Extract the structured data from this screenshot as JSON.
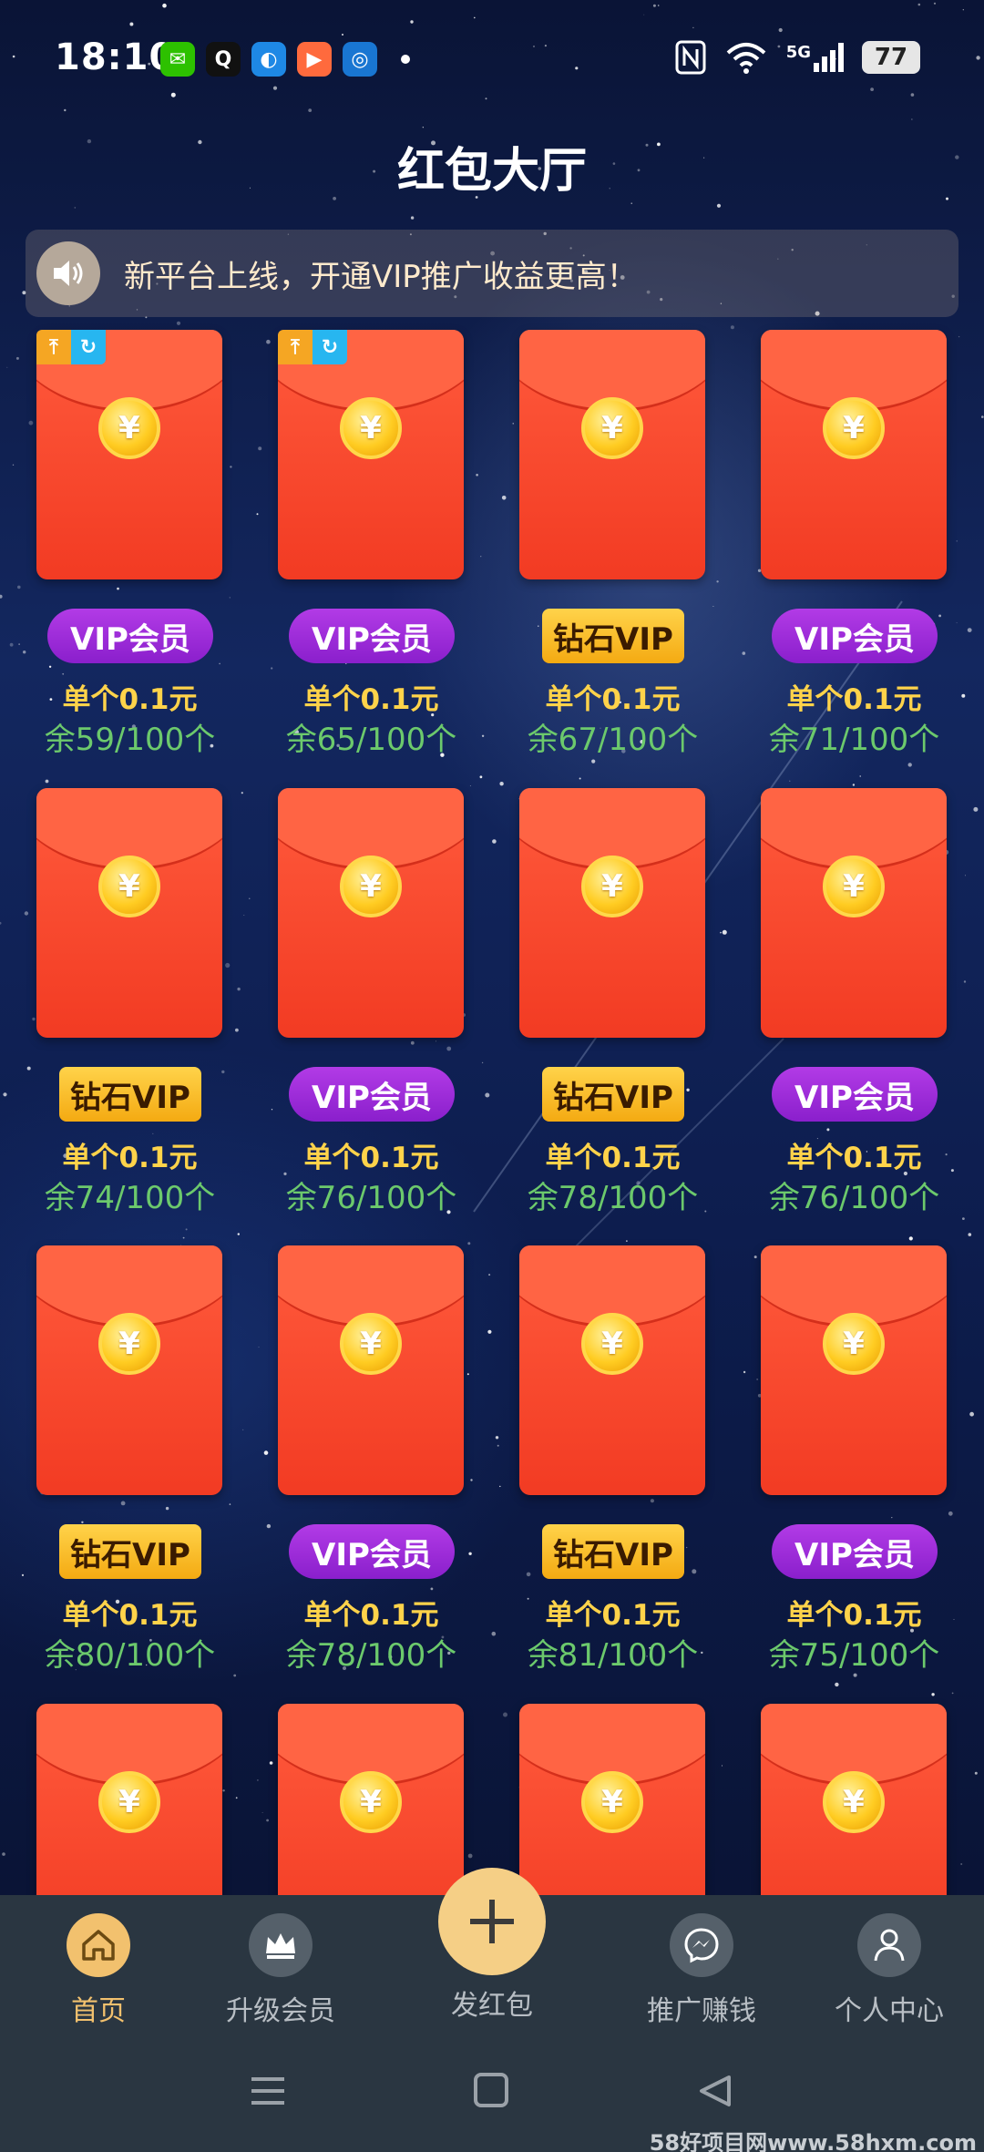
{
  "status_bar": {
    "time": "18:10",
    "apps": [
      {
        "name": "wechat-icon",
        "glyph": "✉",
        "color": "#2dc100"
      },
      {
        "name": "qq-icon",
        "glyph": "Q",
        "color": "#ffffff"
      },
      {
        "name": "browser-icon",
        "glyph": "◐",
        "color": "#1e88e5"
      },
      {
        "name": "video-app-icon",
        "glyph": "▶",
        "color": "#ff6a3d"
      },
      {
        "name": "circle-app-icon",
        "glyph": "◎",
        "color": "#1976d2"
      }
    ],
    "signal": "5G",
    "battery": "77"
  },
  "header": {
    "title": "红包大厅"
  },
  "notice": {
    "text": "新平台上线，开通VIP推广收益更高！"
  },
  "packets": [
    {
      "tier": "VIP会员",
      "tier_type": "vip",
      "price": "单个0.1元",
      "remain": "余59/100个",
      "pinned": true
    },
    {
      "tier": "VIP会员",
      "tier_type": "vip",
      "price": "单个0.1元",
      "remain": "余65/100个",
      "pinned": true
    },
    {
      "tier": "钻石VIP",
      "tier_type": "diamond",
      "price": "单个0.1元",
      "remain": "余67/100个",
      "pinned": false
    },
    {
      "tier": "VIP会员",
      "tier_type": "vip",
      "price": "单个0.1元",
      "remain": "余71/100个",
      "pinned": false
    },
    {
      "tier": "钻石VIP",
      "tier_type": "diamond",
      "price": "单个0.1元",
      "remain": "余74/100个",
      "pinned": false
    },
    {
      "tier": "VIP会员",
      "tier_type": "vip",
      "price": "单个0.1元",
      "remain": "余76/100个",
      "pinned": false
    },
    {
      "tier": "钻石VIP",
      "tier_type": "diamond",
      "price": "单个0.1元",
      "remain": "余78/100个",
      "pinned": false
    },
    {
      "tier": "VIP会员",
      "tier_type": "vip",
      "price": "单个0.1元",
      "remain": "余76/100个",
      "pinned": false
    },
    {
      "tier": "钻石VIP",
      "tier_type": "diamond",
      "price": "单个0.1元",
      "remain": "余80/100个",
      "pinned": false
    },
    {
      "tier": "VIP会员",
      "tier_type": "vip",
      "price": "单个0.1元",
      "remain": "余78/100个",
      "pinned": false
    },
    {
      "tier": "钻石VIP",
      "tier_type": "diamond",
      "price": "单个0.1元",
      "remain": "余81/100个",
      "pinned": false
    },
    {
      "tier": "VIP会员",
      "tier_type": "vip",
      "price": "单个0.1元",
      "remain": "余75/100个",
      "pinned": false
    },
    {
      "tier": "",
      "tier_type": "none",
      "price": "",
      "remain": "",
      "pinned": false
    },
    {
      "tier": "",
      "tier_type": "none",
      "price": "",
      "remain": "",
      "pinned": false
    },
    {
      "tier": "",
      "tier_type": "none",
      "price": "",
      "remain": "",
      "pinned": false
    },
    {
      "tier": "",
      "tier_type": "none",
      "price": "",
      "remain": "",
      "pinned": false
    }
  ],
  "coin_symbol": "¥",
  "badges": {
    "pin": "⤒",
    "refresh": "↻"
  },
  "nav": {
    "items": [
      {
        "label": "首页",
        "icon": "home-icon",
        "active": true
      },
      {
        "label": "升级会员",
        "icon": "crown-icon",
        "active": false
      },
      {
        "label": "推广赚钱",
        "icon": "messenger-icon",
        "active": false
      },
      {
        "label": "个人中心",
        "icon": "user-icon",
        "active": false
      }
    ],
    "fab_label": "发红包"
  },
  "watermark": "58好项目网www.58hxm.com",
  "colors": {
    "accent": "#f2c16e",
    "vip": "#9b2bd8",
    "diamond": "#f7b521",
    "remain": "#6cc96c",
    "price": "#ffd34a"
  }
}
